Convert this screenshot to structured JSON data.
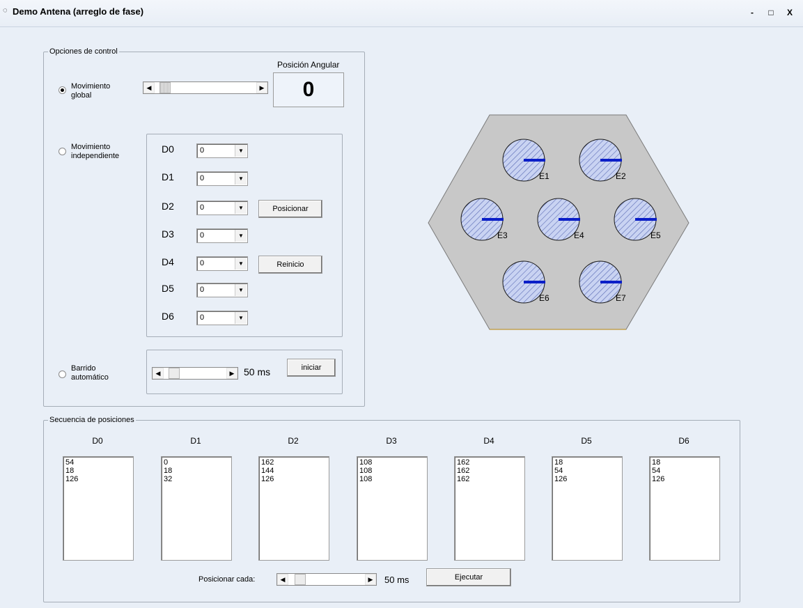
{
  "window": {
    "title": "Demo Antena (arreglo de fase)",
    "app_icon": "antenna-app-icon",
    "min": "-",
    "max": "□",
    "close": "X"
  },
  "control": {
    "legend": "Opciones de control",
    "angular_label": "Posición Angular",
    "angular_value": "0",
    "global": {
      "label_line1": "Movimiento",
      "label_line2": "global",
      "selected": true,
      "scroll_position": 0.05
    },
    "independent": {
      "label_line1": "Movimiento",
      "label_line2": "independiente",
      "selected": false,
      "rows": [
        {
          "label": "D0",
          "value": "0"
        },
        {
          "label": "D1",
          "value": "0"
        },
        {
          "label": "D2",
          "value": "0"
        },
        {
          "label": "D3",
          "value": "0"
        },
        {
          "label": "D4",
          "value": "0"
        },
        {
          "label": "D5",
          "value": "0"
        },
        {
          "label": "D6",
          "value": "0"
        }
      ],
      "position_button": "Posicionar",
      "reset_button": "Reinicio"
    },
    "sweep": {
      "label_line1": "Barrido",
      "label_line2": "automático",
      "selected": false,
      "value": "50 ms",
      "start_button": "iniciar",
      "scroll_position": 0.1
    }
  },
  "antenna": {
    "elements": [
      {
        "label": "E1"
      },
      {
        "label": "E2"
      },
      {
        "label": "E3"
      },
      {
        "label": "E4"
      },
      {
        "label": "E5"
      },
      {
        "label": "E6"
      },
      {
        "label": "E7"
      }
    ],
    "colors": {
      "hexagon": "#c8c8c8",
      "element_fill": "#c9d3f2",
      "hatch": "#5a6bb5",
      "needle": "#0a1ec8"
    }
  },
  "sequence": {
    "legend": "Secuencia de posiciones",
    "columns": [
      {
        "header": "D0",
        "values": [
          "54",
          "18",
          "126"
        ]
      },
      {
        "header": "D1",
        "values": [
          "0",
          "18",
          "32"
        ]
      },
      {
        "header": "D2",
        "values": [
          "162",
          "144",
          "126"
        ]
      },
      {
        "header": "D3",
        "values": [
          "108",
          "108",
          "108"
        ]
      },
      {
        "header": "D4",
        "values": [
          "162",
          "162",
          "162"
        ]
      },
      {
        "header": "D5",
        "values": [
          "18",
          "54",
          "126"
        ]
      },
      {
        "header": "D6",
        "values": [
          "18",
          "54",
          "126"
        ]
      }
    ],
    "interval_label": "Posicionar cada:",
    "interval_value": "50 ms",
    "interval_scroll_position": 0.1,
    "execute_button": "Ejecutar"
  }
}
